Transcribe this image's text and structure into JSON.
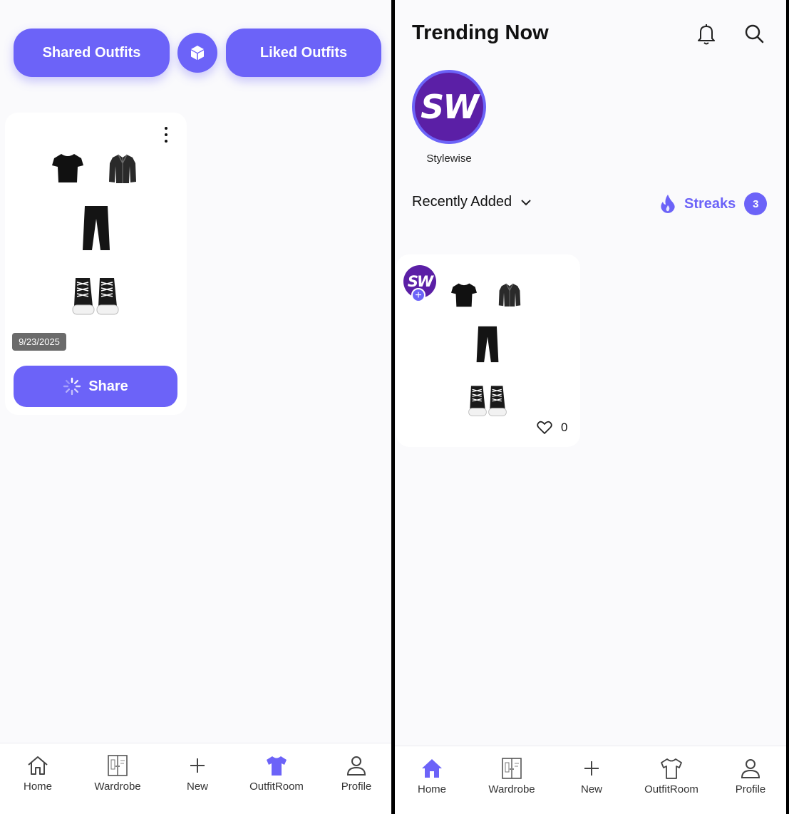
{
  "left": {
    "tabs": {
      "shared_label": "Shared Outfits",
      "liked_label": "Liked Outfits"
    },
    "card": {
      "date": "9/23/2025",
      "share_label": "Share"
    }
  },
  "right": {
    "title": "Trending Now",
    "profile": {
      "initials": "SW",
      "name": "Stylewise"
    },
    "sort": {
      "selected": "Recently Added"
    },
    "streaks": {
      "label": "Streaks",
      "count": "3"
    },
    "card": {
      "avatar_initials": "SW",
      "likes": "0"
    }
  },
  "nav": {
    "home": "Home",
    "wardrobe": "Wardrobe",
    "new": "New",
    "outfitroom": "OutfitRoom",
    "profile": "Profile"
  },
  "colors": {
    "accent": "#6c63f8",
    "avatar": "#5b1fa6",
    "background": "#fafafc"
  }
}
